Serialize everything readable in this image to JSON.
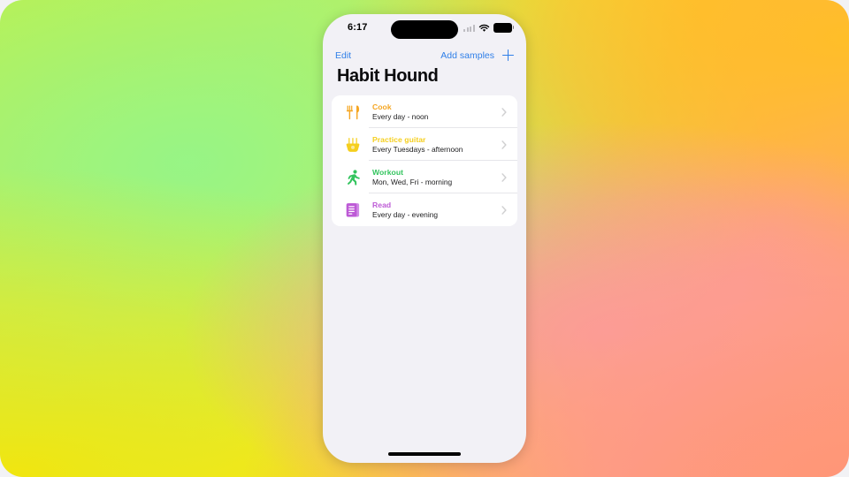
{
  "wallpaper": {
    "name": "colorful-mesh-gradient"
  },
  "phone": {
    "status_bar": {
      "time": "6:17",
      "cellular_icon": "signal-bars-icon",
      "wifi_icon": "wifi-icon",
      "battery_icon": "battery-icon",
      "dynamic_island": "dynamic-island"
    },
    "nav_bar": {
      "edit_label": "Edit",
      "add_samples_label": "Add samples",
      "add_icon": "plus-icon",
      "tint_color": "#2f7fe8"
    },
    "title": "Habit Hound",
    "habits": [
      {
        "name": "Cook",
        "schedule": "Every day - noon",
        "icon": "fork-and-knife-icon",
        "color": "#f5a623",
        "chevron": "chevron-right-icon"
      },
      {
        "name": "Practice guitar",
        "schedule": "Every Tuesdays - afternoon",
        "icon": "guitar-icon",
        "color": "#f5cf1e",
        "chevron": "chevron-right-icon"
      },
      {
        "name": "Workout",
        "schedule": "Mon, Wed, Fri - morning",
        "icon": "running-person-icon",
        "color": "#33c45e",
        "chevron": "chevron-right-icon"
      },
      {
        "name": "Read",
        "schedule": "Every day - evening",
        "icon": "book-icon",
        "color": "#bd5ad6",
        "chevron": "chevron-right-icon"
      }
    ],
    "home_indicator": "home-indicator"
  }
}
